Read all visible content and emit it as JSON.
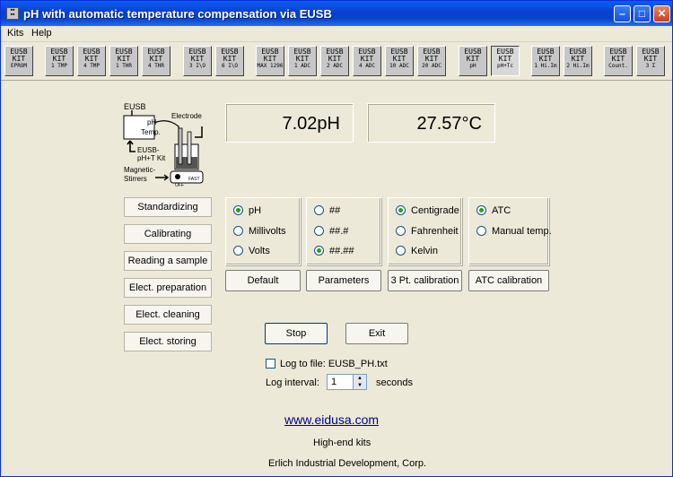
{
  "window": {
    "title": "pH with automatic temperature compensation via EUSB"
  },
  "menu": {
    "kits": "Kits",
    "help": "Help"
  },
  "kits": [
    {
      "l1": "EUSB",
      "l2": "KIT",
      "l3": "EPROM"
    },
    {
      "l1": "EUSB",
      "l2": "KIT",
      "l3": "1 TMP"
    },
    {
      "l1": "EUSB",
      "l2": "KIT",
      "l3": "4 TMP"
    },
    {
      "l1": "EUSB",
      "l2": "KIT",
      "l3": "1 THR"
    },
    {
      "l1": "EUSB",
      "l2": "KIT",
      "l3": "4 THR"
    },
    {
      "l1": "EUSB",
      "l2": "KIT",
      "l3": "3 I\\O"
    },
    {
      "l1": "EUSB",
      "l2": "KIT",
      "l3": "6 I\\O"
    },
    {
      "l1": "EUSB",
      "l2": "KIT",
      "l3": "MAX 1296"
    },
    {
      "l1": "EUSB",
      "l2": "KIT",
      "l3": "1 ADC"
    },
    {
      "l1": "EUSB",
      "l2": "KIT",
      "l3": "2 ADC"
    },
    {
      "l1": "EUSB",
      "l2": "KIT",
      "l3": "4 ADC"
    },
    {
      "l1": "EUSB",
      "l2": "KIT",
      "l3": "10 ADC"
    },
    {
      "l1": "EUSB",
      "l2": "KIT",
      "l3": "20 ADC"
    },
    {
      "l1": "EUSB",
      "l2": "KIT",
      "l3": "pH"
    },
    {
      "l1": "EUSB",
      "l2": "KIT",
      "l3": "pH+Tc"
    },
    {
      "l1": "EUSB",
      "l2": "KIT",
      "l3": "1 Hi.Im"
    },
    {
      "l1": "EUSB",
      "l2": "KIT",
      "l3": "2 Hi.Im"
    },
    {
      "l1": "EUSB",
      "l2": "KIT",
      "l3": "Count."
    },
    {
      "l1": "EUSB",
      "l2": "KIT",
      "l3": "3 Σ"
    }
  ],
  "diagram": {
    "eusb": "EUSB",
    "ph": "pH",
    "temp": "Temp.",
    "electrode": "Electrode",
    "kit1": "EUSB-",
    "kit2": "pH+T Kit",
    "mag1": "Magnetic-",
    "mag2": "Stirrers",
    "off": "OFF",
    "fast": "FAST"
  },
  "readouts": {
    "ph": "7.02pH",
    "temp": "27.57°C"
  },
  "left_buttons": [
    "Standardizing",
    "Calibrating",
    "Reading a sample",
    "Elect. preparation",
    "Elect. cleaning",
    "Elect. storing"
  ],
  "groups": {
    "units": {
      "options": [
        "pH",
        "Millivolts",
        "Volts"
      ],
      "selected": 0
    },
    "precision": {
      "options": [
        "##",
        "##.#",
        "##.##"
      ],
      "selected": 2
    },
    "temperature": {
      "options": [
        "Centigrade",
        "Fahrenheit",
        "Kelvin"
      ],
      "selected": 0
    },
    "compensation": {
      "options": [
        "ATC",
        "Manual temp."
      ],
      "selected": 0
    }
  },
  "row_buttons": {
    "default": "Default",
    "parameters": "Parameters",
    "three_pt": "3 Pt. calibration",
    "atc": "ATC calibration"
  },
  "actions": {
    "stop": "Stop",
    "exit": "Exit"
  },
  "log": {
    "label": "Log to file: EUSB_PH.txt",
    "checked": false,
    "interval_label": "Log interval:",
    "interval_value": "1",
    "seconds": "seconds"
  },
  "footer": {
    "url": "www.eidusa.com",
    "tagline": "High-end kits",
    "company": "Erlich Industrial Development, Corp."
  }
}
